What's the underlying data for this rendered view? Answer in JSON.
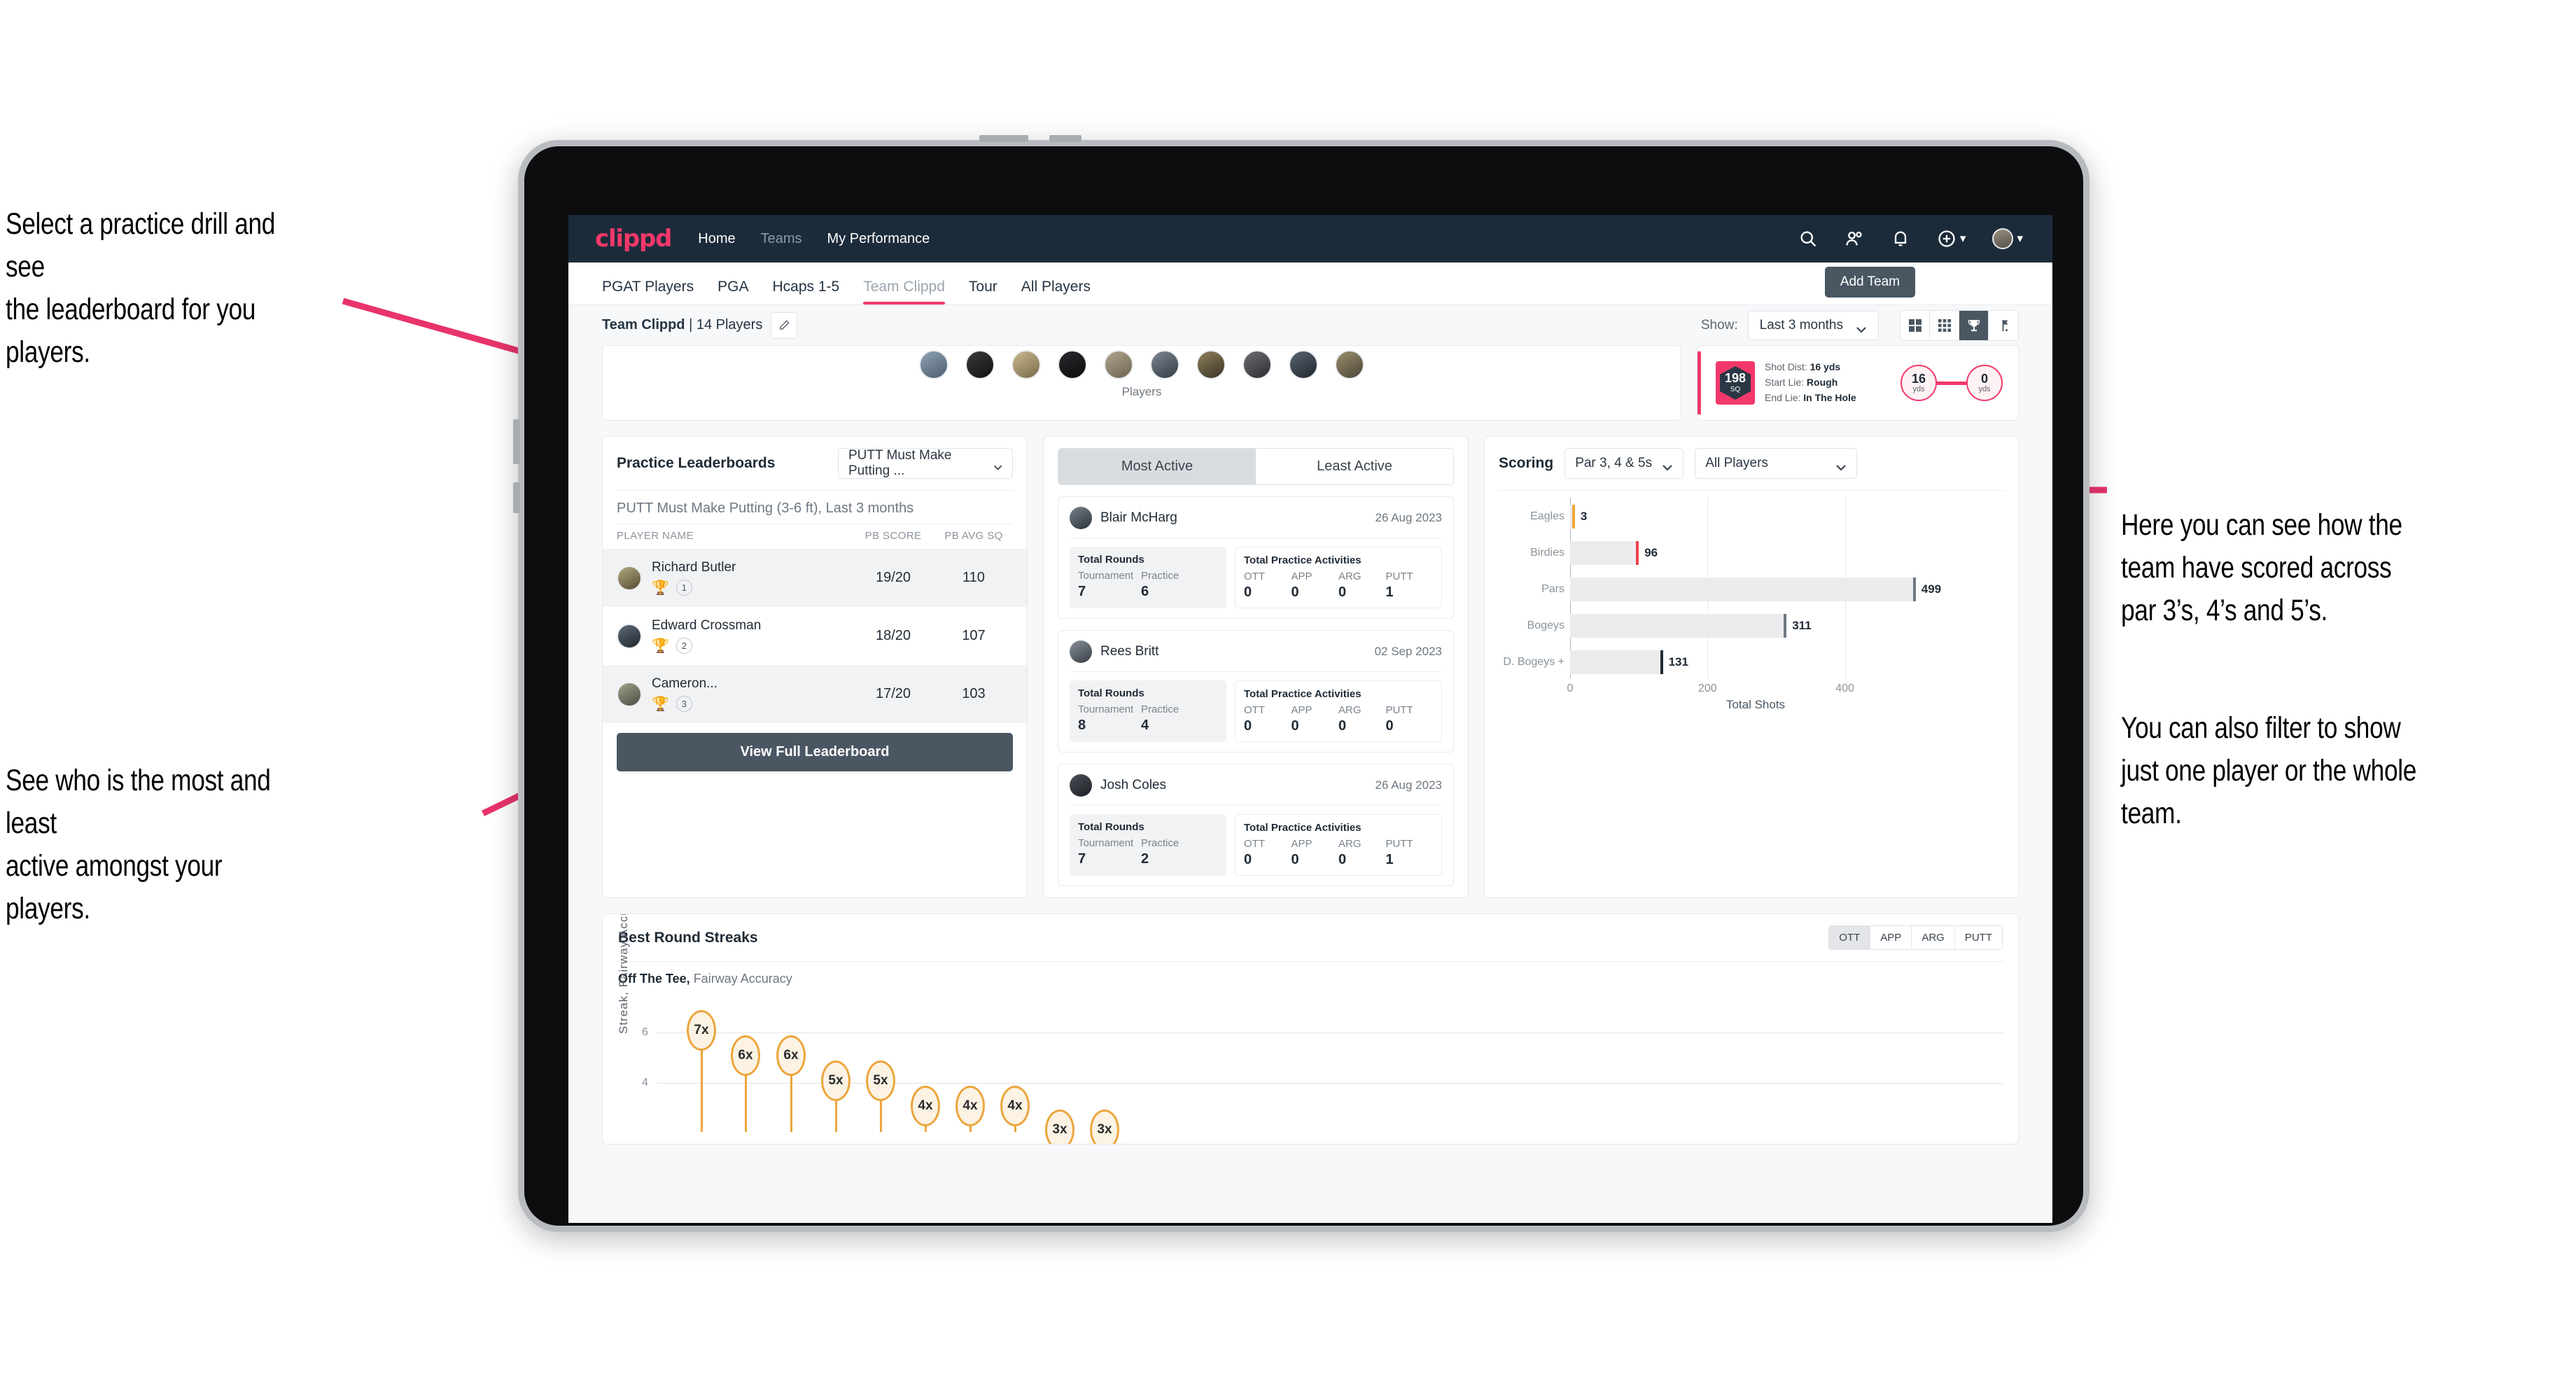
{
  "annotations": {
    "top_left": "Select a practice drill and see\nthe leaderboard for you players.",
    "bottom_left": "See who is the most and least\nactive amongst your players.",
    "right_1": "Here you can see how the\nteam have scored across\npar 3’s, 4’s and 5’s.",
    "right_2": "You can also filter to show\njust one player or the whole\nteam."
  },
  "colors": {
    "accent": "#f2386a",
    "navbar": "#1c2b3a",
    "dark_button": "#4a5763",
    "amber": "#eca53c"
  },
  "navbar": {
    "logo": "clippd",
    "links": [
      {
        "label": "Home",
        "active": true
      },
      {
        "label": "Teams",
        "active": false
      },
      {
        "label": "My Performance",
        "active": true
      }
    ],
    "icons": [
      "search-icon",
      "people-icon",
      "bell-icon",
      "plus-circle-icon",
      "avatar"
    ]
  },
  "tabs": [
    {
      "label": "PGAT Players",
      "active": false
    },
    {
      "label": "PGA",
      "active": false
    },
    {
      "label": "Hcaps 1-5",
      "active": false
    },
    {
      "label": "Team Clippd",
      "active": true
    },
    {
      "label": "Tour",
      "active": false
    },
    {
      "label": "All Players",
      "active": false
    }
  ],
  "add_team_button": "Add Team",
  "subheader": {
    "team_name": "Team Clippd",
    "team_count": "| 14 Players",
    "show_label": "Show:",
    "show_value": "Last 3 months",
    "view_toggles": [
      {
        "name": "grid-large-icon",
        "active": false
      },
      {
        "name": "grid-small-icon",
        "active": false
      },
      {
        "name": "trophy-icon",
        "active": true
      },
      {
        "name": "flag-icon",
        "active": false
      }
    ]
  },
  "players_strip": {
    "caption": "Players",
    "count": 10
  },
  "shot_card": {
    "sq_value": "198",
    "sq_unit": "SQ",
    "shot_dist_label": "Shot Dist:",
    "shot_dist_value": "16 yds",
    "start_lie_label": "Start Lie:",
    "start_lie_value": "Rough",
    "end_lie_label": "End Lie:",
    "end_lie_value": "In The Hole",
    "from_value": "16",
    "from_unit": "yds",
    "to_value": "0",
    "to_unit": "yds"
  },
  "leaderboard": {
    "title": "Practice Leaderboards",
    "drill_select": "PUTT Must Make Putting ...",
    "subtitle_bold": "PUTT Must Make Putting (3-6 ft),",
    "subtitle_light": " Last 3 months",
    "columns": [
      "PLAYER NAME",
      "PB SCORE",
      "PB AVG SQ"
    ],
    "rows": [
      {
        "name": "Richard Butler",
        "rank": "1",
        "trophy": "gold",
        "pb_score": "19/20",
        "pb_avg_sq": "110"
      },
      {
        "name": "Edward Crossman",
        "rank": "2",
        "trophy": "silver",
        "pb_score": "18/20",
        "pb_avg_sq": "107"
      },
      {
        "name": "Cameron...",
        "rank": "3",
        "trophy": "bronze",
        "pb_score": "17/20",
        "pb_avg_sq": "103"
      }
    ],
    "view_button": "View Full Leaderboard"
  },
  "activity": {
    "tabs": [
      {
        "label": "Most Active",
        "active": true
      },
      {
        "label": "Least Active",
        "active": false
      }
    ],
    "rounds_header": "Total Rounds",
    "rounds_keys": [
      "Tournament",
      "Practice"
    ],
    "acts_header": "Total Practice Activities",
    "acts_keys": [
      "OTT",
      "APP",
      "ARG",
      "PUTT"
    ],
    "cards": [
      {
        "name": "Blair McHarg",
        "date": "26 Aug 2023",
        "rounds": [
          "7",
          "6"
        ],
        "acts": [
          "0",
          "0",
          "0",
          "1"
        ]
      },
      {
        "name": "Rees Britt",
        "date": "02 Sep 2023",
        "rounds": [
          "8",
          "4"
        ],
        "acts": [
          "0",
          "0",
          "0",
          "0"
        ]
      },
      {
        "name": "Josh Coles",
        "date": "26 Aug 2023",
        "rounds": [
          "7",
          "2"
        ],
        "acts": [
          "0",
          "0",
          "0",
          "1"
        ]
      }
    ]
  },
  "scoring": {
    "title": "Scoring",
    "par_select": "Par 3, 4 & 5s",
    "players_select": "All Players"
  },
  "streaks": {
    "title": "Best Round Streaks",
    "segments": [
      {
        "label": "OTT",
        "active": true
      },
      {
        "label": "APP",
        "active": false
      },
      {
        "label": "ARG",
        "active": false
      },
      {
        "label": "PUTT",
        "active": false
      }
    ],
    "subtitle_bold": "Off The Tee,",
    "subtitle_light": " Fairway Accuracy"
  },
  "chart_data": [
    {
      "type": "bar",
      "orientation": "horizontal",
      "title": "Scoring",
      "categories": [
        "Eagles",
        "Birdies",
        "Pars",
        "Bogeys",
        "D. Bogeys +"
      ],
      "values": [
        3,
        96,
        499,
        311,
        131
      ],
      "cap_colors": [
        "#f0a93a",
        "#ef3f4a",
        "#6f7880",
        "#6f7880",
        "#1f2a35"
      ],
      "xlabel": "Total Shots",
      "ylabel": "",
      "xlim": [
        0,
        540
      ],
      "xticks": [
        0,
        200,
        400
      ],
      "grid": true,
      "legend": "none"
    },
    {
      "type": "scatter",
      "title": "Best Round Streaks",
      "subtitle": "Off The Tee, Fairway Accuracy",
      "ylabel": "Streak, Fairway Accuracy",
      "xlabel": "",
      "ylim": [
        0,
        7.6
      ],
      "yticks": [
        4,
        6
      ],
      "grid": true,
      "labels": [
        "7x",
        "6x",
        "6x",
        "5x",
        "5x",
        "4x",
        "4x",
        "4x",
        "3x",
        "3x"
      ],
      "values": [
        7,
        6,
        6,
        5,
        5,
        4,
        4,
        4,
        3,
        3
      ]
    }
  ]
}
